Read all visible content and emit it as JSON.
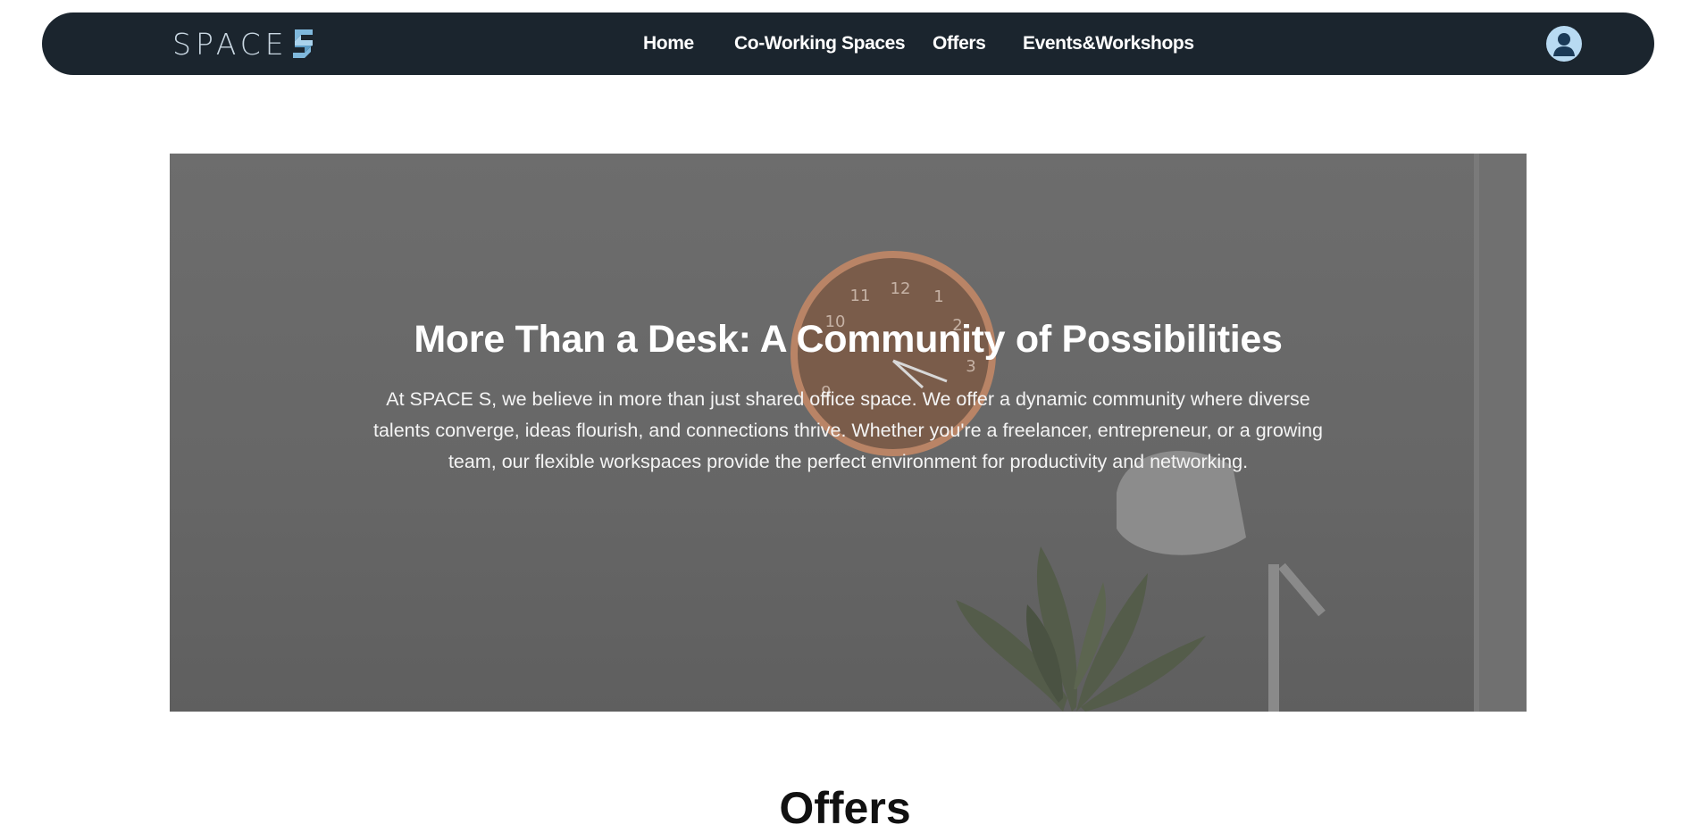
{
  "navbar": {
    "logo": {
      "text": "SPACE",
      "mark_letter": "S",
      "mark_color": "#7fb8dc"
    },
    "links": [
      {
        "label": "Home"
      },
      {
        "label": "Co-Working Spaces"
      },
      {
        "label": "Offers"
      },
      {
        "label": "Events&Workshops"
      }
    ],
    "avatar_icon": "user-circle-icon",
    "background": "#1b252e"
  },
  "hero": {
    "title": "More Than a Desk: A Community of Possibilities",
    "body": "At SPACE S, we believe in more than just shared office space. We offer a dynamic community where diverse talents converge, ideas flourish, and connections thrive. Whether you're a freelancer, entrepreneur, or a growing team, our flexible workspaces provide the perfect environment for productivity and networking.",
    "clock_numerals": [
      "12",
      "11",
      "1",
      "10",
      "2",
      "9",
      "3"
    ]
  },
  "offers_section": {
    "title": "Offers"
  }
}
